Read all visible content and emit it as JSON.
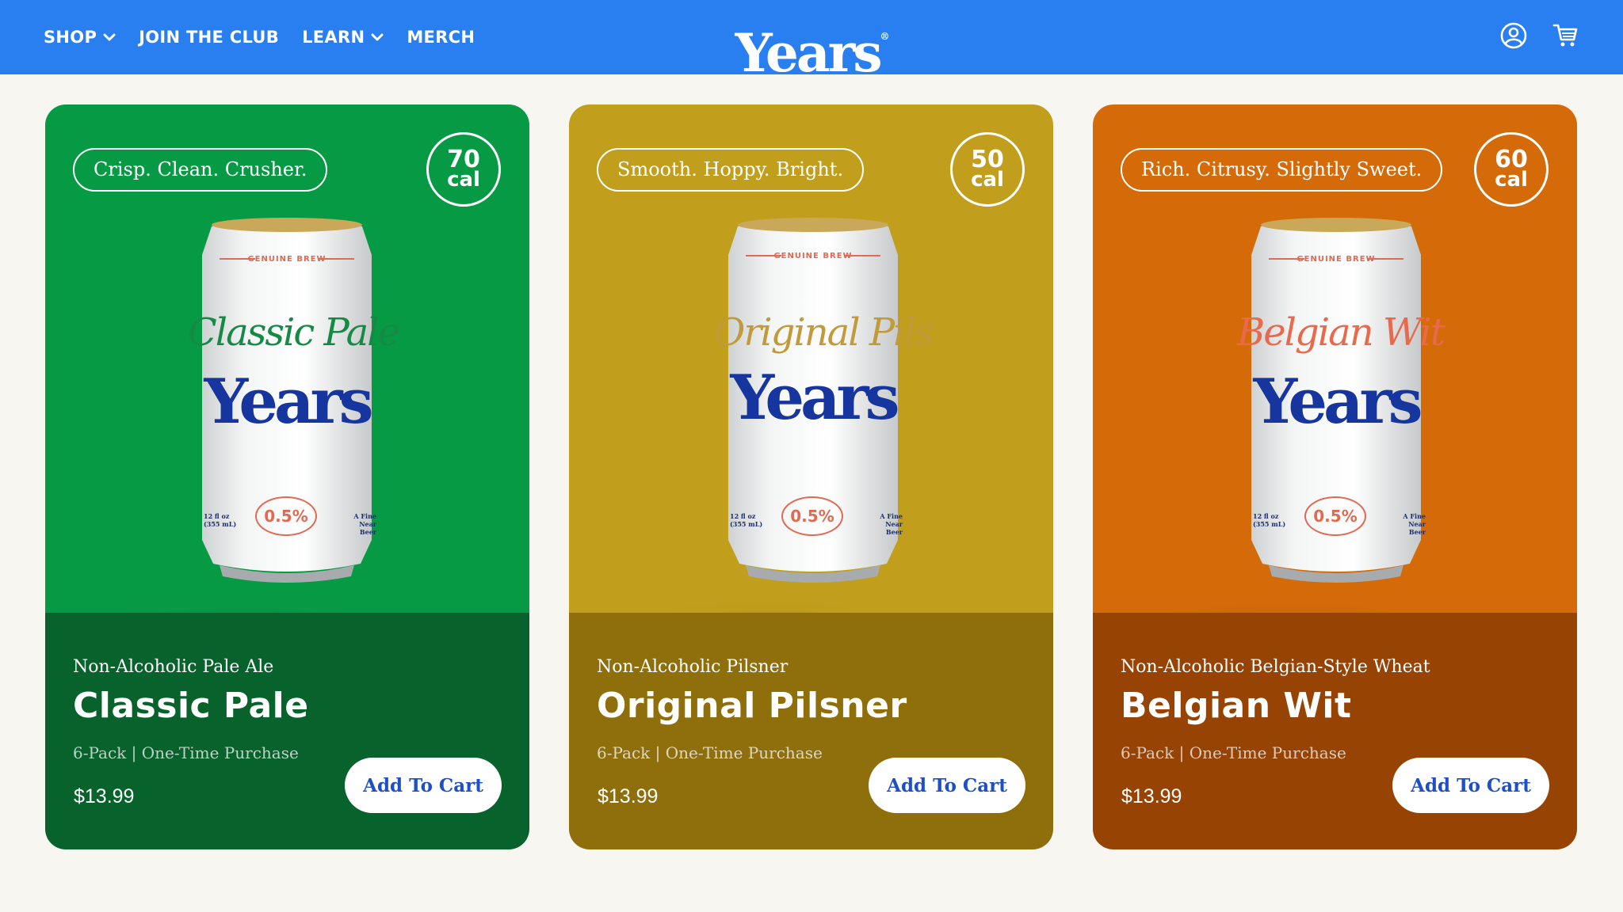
{
  "header": {
    "logo": "Years",
    "logo_mark": "®",
    "nav": [
      {
        "label": "SHOP",
        "has_dropdown": true
      },
      {
        "label": "JOIN THE CLUB",
        "has_dropdown": false
      },
      {
        "label": "LEARN",
        "has_dropdown": true
      },
      {
        "label": "MERCH",
        "has_dropdown": false
      }
    ],
    "icons": [
      "account-icon",
      "cart-icon"
    ],
    "background": "#2a7ff0"
  },
  "products": [
    {
      "tagline": "Crisp. Clean. Crusher.",
      "calories": "70",
      "cal_unit": "cal",
      "can_name": "Classic Pale",
      "can_brand": "Years",
      "can_brew": "GENUINE BREW",
      "can_abv": "0.5%",
      "can_volume": "12 fl oz (355 mL)",
      "can_fine": "A Fine Near Beer",
      "type": "Non-Alcoholic Pale Ale",
      "name": "Classic Pale",
      "pack": "6-Pack | One-Time Purchase",
      "price": "$13.99",
      "button": "Add To Cart",
      "color_top": "#079a44",
      "color_bottom": "#07622c",
      "can_name_color": "#168a45"
    },
    {
      "tagline": "Smooth. Hoppy. Bright.",
      "calories": "50",
      "cal_unit": "cal",
      "can_name": "Original Pils",
      "can_brand": "Years",
      "can_brew": "GENUINE BREW",
      "can_abv": "0.5%",
      "can_volume": "12 fl oz (355 mL)",
      "can_fine": "A Fine Near Beer",
      "type": "Non-Alcoholic Pilsner",
      "name": "Original Pilsner",
      "pack": "6-Pack | One-Time Purchase",
      "price": "$13.99",
      "button": "Add To Cart",
      "color_top": "#c19e1c",
      "color_bottom": "#8e6f0b",
      "can_name_color": "#c19a3a"
    },
    {
      "tagline": "Rich. Citrusy. Slightly Sweet.",
      "calories": "60",
      "cal_unit": "cal",
      "can_name": "Belgian Wit",
      "can_brand": "Years",
      "can_brew": "GENUINE BREW",
      "can_abv": "0.5%",
      "can_volume": "12 fl oz (355 mL)",
      "can_fine": "A Fine Near Beer",
      "type": "Non-Alcoholic Belgian-Style Wheat",
      "name": "Belgian Wit",
      "pack": "6-Pack | One-Time Purchase",
      "price": "$13.99",
      "button": "Add To Cart",
      "color_top": "#d46a08",
      "color_bottom": "#964304",
      "can_name_color": "#e8694c"
    }
  ]
}
